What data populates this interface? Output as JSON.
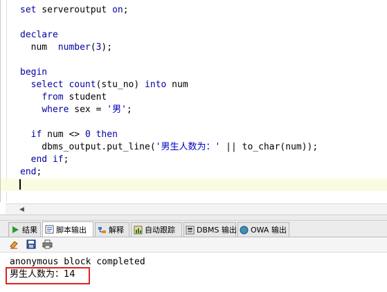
{
  "editor": {
    "lines": [
      [
        {
          "t": "set",
          "c": "kw"
        },
        {
          "t": " serveroutput "
        },
        {
          "t": "on",
          "c": "kw"
        },
        {
          "t": ";"
        }
      ],
      [],
      [
        {
          "t": "declare",
          "c": "kw"
        }
      ],
      [
        {
          "t": "  num  "
        },
        {
          "t": "number",
          "c": "kw"
        },
        {
          "t": "("
        },
        {
          "t": "3",
          "c": "num"
        },
        {
          "t": ");"
        }
      ],
      [],
      [
        {
          "t": "begin",
          "c": "kw"
        }
      ],
      [
        {
          "t": "  "
        },
        {
          "t": "select",
          "c": "kw"
        },
        {
          "t": " "
        },
        {
          "t": "count",
          "c": "kw"
        },
        {
          "t": "(stu_no) "
        },
        {
          "t": "into",
          "c": "kw"
        },
        {
          "t": " num"
        }
      ],
      [
        {
          "t": "    "
        },
        {
          "t": "from",
          "c": "kw"
        },
        {
          "t": " student"
        }
      ],
      [
        {
          "t": "    "
        },
        {
          "t": "where",
          "c": "kw"
        },
        {
          "t": " sex = "
        },
        {
          "t": "'男'",
          "c": "str"
        },
        {
          "t": ";"
        }
      ],
      [],
      [
        {
          "t": "  "
        },
        {
          "t": "if",
          "c": "kw"
        },
        {
          "t": " num <> "
        },
        {
          "t": "0",
          "c": "num"
        },
        {
          "t": " "
        },
        {
          "t": "then",
          "c": "kw"
        }
      ],
      [
        {
          "t": "    dbms_output.put_line("
        },
        {
          "t": "'男生人数为：'",
          "c": "str"
        },
        {
          "t": " || to_char(num));"
        }
      ],
      [
        {
          "t": "  "
        },
        {
          "t": "end if",
          "c": "kw"
        },
        {
          "t": ";"
        }
      ],
      [
        {
          "t": "end",
          "c": "kw"
        },
        {
          "t": ";"
        }
      ]
    ]
  },
  "tabs": [
    {
      "label": "结果",
      "icon": "play-icon",
      "active": false
    },
    {
      "label": "脚本输出",
      "icon": "script-output-icon",
      "active": true
    },
    {
      "label": "解释",
      "icon": "explain-plan-icon",
      "active": false
    },
    {
      "label": "自动跟踪",
      "icon": "autotrace-icon",
      "active": false
    },
    {
      "label": "DBMS 输出",
      "icon": "dbms-output-icon",
      "active": false
    },
    {
      "label": "OWA 输出",
      "icon": "owa-output-icon",
      "active": false
    }
  ],
  "toolbar": {
    "buttons": [
      {
        "icon": "eraser-icon"
      },
      {
        "icon": "save-icon"
      },
      {
        "icon": "print-icon"
      }
    ]
  },
  "output": {
    "line1": "anonymous block completed",
    "line2": "男生人数为：14"
  },
  "colors": {
    "keyword": "#0000a0",
    "highlight_border": "#e02020",
    "current_line": "#fbfbe2"
  }
}
